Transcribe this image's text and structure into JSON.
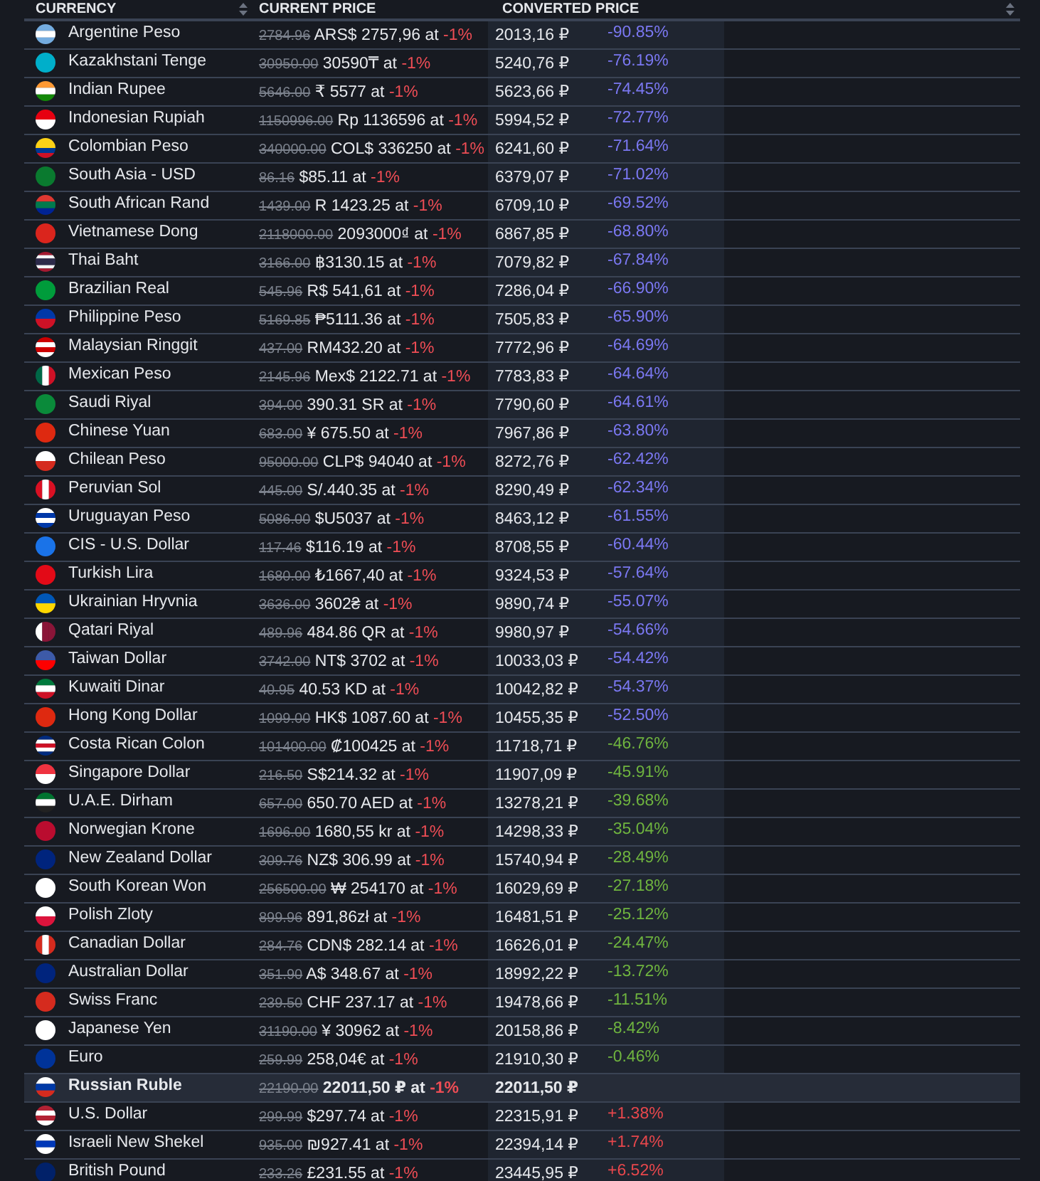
{
  "table": {
    "columns": [
      {
        "label": "CURRENCY",
        "sortable": true
      },
      {
        "label": "CURRENT PRICE",
        "sortable": false
      },
      {
        "label": "CONVERTED PRICE",
        "sortable": false
      },
      {
        "sortable": true
      }
    ],
    "rows": [
      {
        "name": "Argentine Peso",
        "old_price": "2784.96",
        "price": "ARS$ 2757,96 at",
        "discount": "-1%",
        "converted": "2013,16 ₽",
        "change": "-90.85%",
        "color": "#7b78f2",
        "selected": false
      },
      {
        "name": "Kazakhstani Tenge",
        "old_price": "30950.00",
        "price": "30590₸ at",
        "discount": "-1%",
        "converted": "5240,76 ₽",
        "change": "-76.19%",
        "color": "#7b78f2",
        "selected": false
      },
      {
        "name": "Indian Rupee",
        "old_price": "5646.00",
        "price": "₹ 5577 at",
        "discount": "-1%",
        "converted": "5623,66 ₽",
        "change": "-74.45%",
        "color": "#7b78f2",
        "selected": false
      },
      {
        "name": "Indonesian Rupiah",
        "old_price": "1150996.00",
        "price": "Rp 1136596 at",
        "discount": "-1%",
        "converted": "5994,52 ₽",
        "change": "-72.77%",
        "color": "#7b78f2",
        "selected": false
      },
      {
        "name": "Colombian Peso",
        "old_price": "340000.00",
        "price": "COL$ 336250 at",
        "discount": "-1%",
        "converted": "6241,60 ₽",
        "change": "-71.64%",
        "color": "#7b78f2",
        "selected": false
      },
      {
        "name": "South Asia - USD",
        "old_price": "86.16",
        "price": "$85.11 at",
        "discount": "-1%",
        "converted": "6379,07 ₽",
        "change": "-71.02%",
        "color": "#7b78f2",
        "selected": false
      },
      {
        "name": "South African Rand",
        "old_price": "1439.00",
        "price": "R 1423.25 at",
        "discount": "-1%",
        "converted": "6709,10 ₽",
        "change": "-69.52%",
        "color": "#7b78f2",
        "selected": false
      },
      {
        "name": "Vietnamese Dong",
        "old_price": "2118000.00",
        "price": "2093000₫ at",
        "discount": "-1%",
        "converted": "6867,85 ₽",
        "change": "-68.80%",
        "color": "#7b78f2",
        "selected": false
      },
      {
        "name": "Thai Baht",
        "old_price": "3166.00",
        "price": "฿3130.15 at",
        "discount": "-1%",
        "converted": "7079,82 ₽",
        "change": "-67.84%",
        "color": "#7b78f2",
        "selected": false
      },
      {
        "name": "Brazilian Real",
        "old_price": "545.96",
        "price": "R$ 541,61 at",
        "discount": "-1%",
        "converted": "7286,04 ₽",
        "change": "-66.90%",
        "color": "#7b78f2",
        "selected": false
      },
      {
        "name": "Philippine Peso",
        "old_price": "5169.85",
        "price": "₱5111.36 at",
        "discount": "-1%",
        "converted": "7505,83 ₽",
        "change": "-65.90%",
        "color": "#7b78f2",
        "selected": false
      },
      {
        "name": "Malaysian Ringgit",
        "old_price": "437.00",
        "price": "RM432.20 at",
        "discount": "-1%",
        "converted": "7772,96 ₽",
        "change": "-64.69%",
        "color": "#7b78f2",
        "selected": false
      },
      {
        "name": "Mexican Peso",
        "old_price": "2145.96",
        "price": "Mex$ 2122.71 at",
        "discount": "-1%",
        "converted": "7783,83 ₽",
        "change": "-64.64%",
        "color": "#7b78f2",
        "selected": false
      },
      {
        "name": "Saudi Riyal",
        "old_price": "394.00",
        "price": "390.31 SR at",
        "discount": "-1%",
        "converted": "7790,60 ₽",
        "change": "-64.61%",
        "color": "#7b78f2",
        "selected": false
      },
      {
        "name": "Chinese Yuan",
        "old_price": "683.00",
        "price": "¥ 675.50 at",
        "discount": "-1%",
        "converted": "7967,86 ₽",
        "change": "-63.80%",
        "color": "#7b78f2",
        "selected": false
      },
      {
        "name": "Chilean Peso",
        "old_price": "95000.00",
        "price": "CLP$ 94040 at",
        "discount": "-1%",
        "converted": "8272,76 ₽",
        "change": "-62.42%",
        "color": "#7b78f2",
        "selected": false
      },
      {
        "name": "Peruvian Sol",
        "old_price": "445.00",
        "price": "S/.440.35 at",
        "discount": "-1%",
        "converted": "8290,49 ₽",
        "change": "-62.34%",
        "color": "#7b78f2",
        "selected": false
      },
      {
        "name": "Uruguayan Peso",
        "old_price": "5086.00",
        "price": "$U5037 at",
        "discount": "-1%",
        "converted": "8463,12 ₽",
        "change": "-61.55%",
        "color": "#7b78f2",
        "selected": false
      },
      {
        "name": "CIS - U.S. Dollar",
        "old_price": "117.46",
        "price": "$116.19 at",
        "discount": "-1%",
        "converted": "8708,55 ₽",
        "change": "-60.44%",
        "color": "#7b78f2",
        "selected": false
      },
      {
        "name": "Turkish Lira",
        "old_price": "1680.00",
        "price": "₺1667,40 at",
        "discount": "-1%",
        "converted": "9324,53 ₽",
        "change": "-57.64%",
        "color": "#7b78f2",
        "selected": false
      },
      {
        "name": "Ukrainian Hryvnia",
        "old_price": "3636.00",
        "price": "3602₴ at",
        "discount": "-1%",
        "converted": "9890,74 ₽",
        "change": "-55.07%",
        "color": "#7b78f2",
        "selected": false
      },
      {
        "name": "Qatari Riyal",
        "old_price": "489.96",
        "price": "484.86 QR at",
        "discount": "-1%",
        "converted": "9980,97 ₽",
        "change": "-54.66%",
        "color": "#7b78f2",
        "selected": false
      },
      {
        "name": "Taiwan Dollar",
        "old_price": "3742.00",
        "price": "NT$ 3702 at",
        "discount": "-1%",
        "converted": "10033,03 ₽",
        "change": "-54.42%",
        "color": "#7b78f2",
        "selected": false
      },
      {
        "name": "Kuwaiti Dinar",
        "old_price": "40.95",
        "price": "40.53 KD at",
        "discount": "-1%",
        "converted": "10042,82 ₽",
        "change": "-54.37%",
        "color": "#7b78f2",
        "selected": false
      },
      {
        "name": "Hong Kong Dollar",
        "old_price": "1099.00",
        "price": "HK$ 1087.60 at",
        "discount": "-1%",
        "converted": "10455,35 ₽",
        "change": "-52.50%",
        "color": "#7b78f2",
        "selected": false
      },
      {
        "name": "Costa Rican Colon",
        "old_price": "101400.00",
        "price": "₡100425 at",
        "discount": "-1%",
        "converted": "11718,71 ₽",
        "change": "-46.76%",
        "color": "#6fb43f",
        "selected": false
      },
      {
        "name": "Singapore Dollar",
        "old_price": "216.50",
        "price": "S$214.32 at",
        "discount": "-1%",
        "converted": "11907,09 ₽",
        "change": "-45.91%",
        "color": "#6fb43f",
        "selected": false
      },
      {
        "name": "U.A.E. Dirham",
        "old_price": "657.00",
        "price": "650.70 AED at",
        "discount": "-1%",
        "converted": "13278,21 ₽",
        "change": "-39.68%",
        "color": "#6fb43f",
        "selected": false
      },
      {
        "name": "Norwegian Krone",
        "old_price": "1696.00",
        "price": "1680,55 kr at",
        "discount": "-1%",
        "converted": "14298,33 ₽",
        "change": "-35.04%",
        "color": "#6fb43f",
        "selected": false
      },
      {
        "name": "New Zealand Dollar",
        "old_price": "309.76",
        "price": "NZ$ 306.99 at",
        "discount": "-1%",
        "converted": "15740,94 ₽",
        "change": "-28.49%",
        "color": "#6fb43f",
        "selected": false
      },
      {
        "name": "South Korean Won",
        "old_price": "256500.00",
        "price": "₩ 254170 at",
        "discount": "-1%",
        "converted": "16029,69 ₽",
        "change": "-27.18%",
        "color": "#6fb43f",
        "selected": false
      },
      {
        "name": "Polish Zloty",
        "old_price": "899.96",
        "price": "891,86zł at",
        "discount": "-1%",
        "converted": "16481,51 ₽",
        "change": "-25.12%",
        "color": "#6fb43f",
        "selected": false
      },
      {
        "name": "Canadian Dollar",
        "old_price": "284.76",
        "price": "CDN$ 282.14 at",
        "discount": "-1%",
        "converted": "16626,01 ₽",
        "change": "-24.47%",
        "color": "#6fb43f",
        "selected": false
      },
      {
        "name": "Australian Dollar",
        "old_price": "351.90",
        "price": "A$ 348.67 at",
        "discount": "-1%",
        "converted": "18992,22 ₽",
        "change": "-13.72%",
        "color": "#6fb43f",
        "selected": false
      },
      {
        "name": "Swiss Franc",
        "old_price": "239.50",
        "price": "CHF 237.17 at",
        "discount": "-1%",
        "converted": "19478,66 ₽",
        "change": "-11.51%",
        "color": "#6fb43f",
        "selected": false
      },
      {
        "name": "Japanese Yen",
        "old_price": "31190.00",
        "price": "¥ 30962 at",
        "discount": "-1%",
        "converted": "20158,86 ₽",
        "change": "-8.42%",
        "color": "#6fb43f",
        "selected": false
      },
      {
        "name": "Euro",
        "old_price": "259.99",
        "price": "258,04€ at",
        "discount": "-1%",
        "converted": "21910,30 ₽",
        "change": "-0.46%",
        "color": "#6fb43f",
        "selected": false
      },
      {
        "name": "Russian Ruble",
        "old_price": "22190.00",
        "price": "22011,50 ₽ at",
        "discount": "-1%",
        "converted": "22011,50 ₽",
        "selected": true
      },
      {
        "name": "U.S. Dollar",
        "old_price": "299.99",
        "price": "$297.74 at",
        "discount": "-1%",
        "converted": "22315,91 ₽",
        "change": "+1.38%",
        "color": "#e8474c",
        "selected": false
      },
      {
        "name": "Israeli New Shekel",
        "old_price": "935.00",
        "price": "₪927.41 at",
        "discount": "-1%",
        "converted": "22394,14 ₽",
        "change": "+1.74%",
        "color": "#e8474c",
        "selected": false
      },
      {
        "name": "British Pound",
        "old_price": "233.26",
        "price": "£231.55 at",
        "discount": "-1%",
        "converted": "23445,95 ₽",
        "change": "+6.52%",
        "color": "#e8474c",
        "selected": false
      }
    ]
  }
}
